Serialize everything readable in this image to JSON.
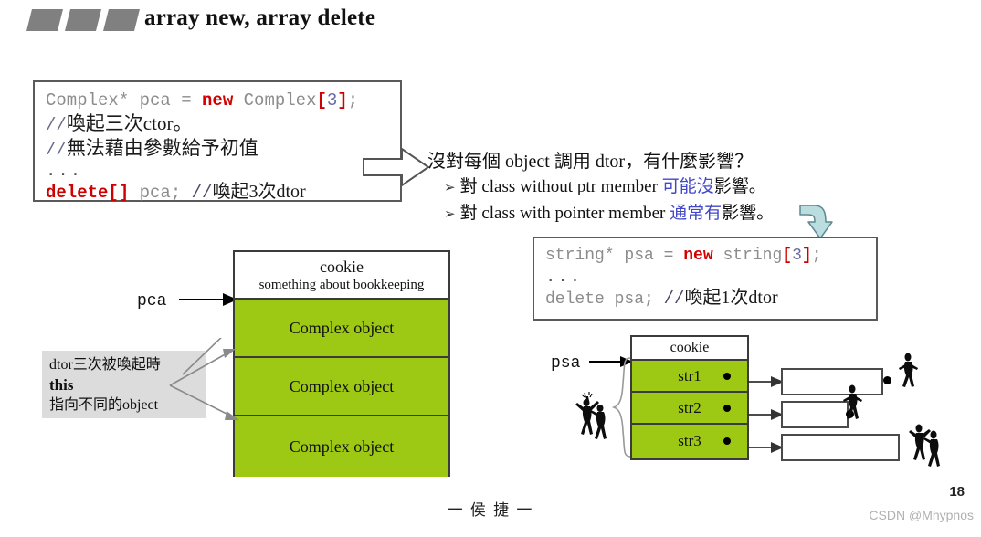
{
  "slide": {
    "title": "array new, array delete",
    "page_number": "18",
    "author_footer": "一 侯 捷 一",
    "watermark": "CSDN @Mhypnos",
    "accent_green": "#9dc814",
    "accent_red": "#d00000",
    "accent_blue": "#4147c8",
    "header_bar_color": "#808080"
  },
  "code_box_complex": {
    "line1": {
      "part1": "Complex* pca = ",
      "keyword": "new",
      "part2": " Complex",
      "bracket_open": "[",
      "number": "3",
      "bracket_close": "]",
      "semicolon": ";"
    },
    "comment1_slashes": "//",
    "comment1": "喚起三次ctor。",
    "comment2_slashes": "//",
    "comment2": "無法藉由參數給予初值",
    "ellipsis": "...",
    "line_delete": {
      "keyword": "delete[]",
      "var": " pca;  ",
      "comment_slashes": "//",
      "comment": "喚起3次dtor"
    }
  },
  "code_box_string": {
    "line1": {
      "part1": "string* psa = ",
      "keyword": "new",
      "part2": " string",
      "bracket_open": "[",
      "number": "3",
      "bracket_close": "]",
      "semicolon": ";"
    },
    "ellipsis": "...",
    "line_delete": {
      "text": "delete psa;  ",
      "comment_slashes": "//",
      "comment": "喚起1次dtor"
    }
  },
  "question_block": {
    "main": "沒對每個 object 調用 dtor，有什麼影響？",
    "bullets": [
      {
        "marker": "➢",
        "text_before": "對 class without ptr member ",
        "highlight": "可能沒",
        "text_after": "影響。"
      },
      {
        "marker": "➢",
        "text_before": "對 class with pointer member ",
        "highlight": "通常有",
        "text_after": "影響。"
      }
    ]
  },
  "pca_diagram": {
    "pointer_label": "pca",
    "cookie_title": "cookie",
    "cookie_subtitle": "something about bookkeeping",
    "cells": [
      "Complex object",
      "Complex object",
      "Complex object"
    ]
  },
  "dtor_note": {
    "line1": "dtor三次被喚起時",
    "line2": "this",
    "line3": "指向不同的object"
  },
  "psa_diagram": {
    "pointer_label": "psa",
    "cookie_title": "cookie",
    "cells": [
      "str1",
      "str2",
      "str3"
    ],
    "heap_boxes": [
      "",
      "",
      ""
    ]
  }
}
